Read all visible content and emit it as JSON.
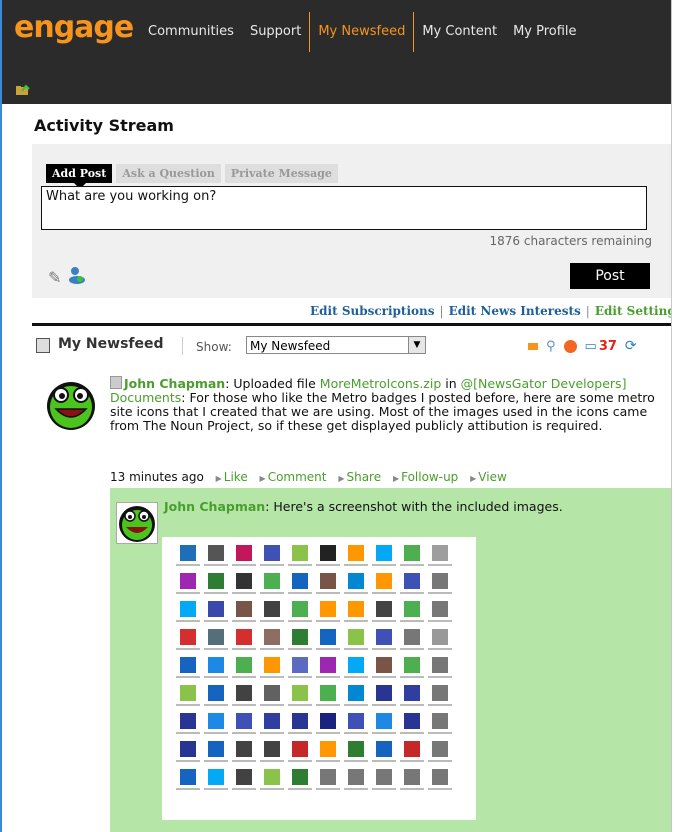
{
  "app": {
    "logo": "engage"
  },
  "nav": {
    "items": [
      "Communities",
      "Support",
      "My Newsfeed",
      "My Content",
      "My Profile"
    ],
    "active_index": 2
  },
  "stream": {
    "title": "Activity Stream",
    "tabs": [
      "Add Post",
      "Ask a Question",
      "Private Message"
    ],
    "post_value": "What are you working on?",
    "chars_remaining": "1876 characters remaining",
    "post_button": "Post"
  },
  "edit_links": [
    "Edit Subscriptions",
    "Edit News Interests",
    "Edit Settings"
  ],
  "feed": {
    "title": "My Newsfeed",
    "show_label": "Show:",
    "show_value": "My Newsfeed",
    "comment_count": "37"
  },
  "post": {
    "author": "John Chapman",
    "text_a": ": Uploaded file ",
    "file": "MoreMetroIcons.zip",
    "text_b": " in ",
    "location": "@[NewsGator Developers] Documents",
    "text_c": ": For those who like the Metro badges I posted before, here are some metro site icons that I created that we are using. Most of the images used in the icons came from The Noun Project, so if these get displayed publicly attibution is required.",
    "time": "13 minutes ago",
    "actions": [
      "Like",
      "Comment",
      "Share",
      "Follow-up",
      "View"
    ]
  },
  "comment": {
    "author": "John Chapman",
    "text": ": Here's a screenshot with the included images."
  },
  "colors": {
    "accent": "#f7941d",
    "link_green": "#4a9e2e",
    "comment_bg": "#b5e6a8",
    "topbar": "#2b2b2b"
  },
  "icon_colors": [
    "#1e6fb8",
    "#555555",
    "#c2185b",
    "#3f51b5",
    "#8bc34a",
    "#222222",
    "#ff9800",
    "#03a9f4",
    "#4caf50",
    "#9e9e9e",
    "#9c27b0",
    "#2e7d32",
    "#333333",
    "#4caf50",
    "#1565c0",
    "#795548",
    "#0288d1",
    "#ff9800",
    "#3f51b5",
    "#777777",
    "#03a9f4",
    "#3949ab",
    "#795548",
    "#424242",
    "#4caf50",
    "#ff9800",
    "#ff9800",
    "#444444",
    "#4caf50",
    "#777777",
    "#d32f2f",
    "#546e7a",
    "#d32f2f",
    "#8d6e63",
    "#2e7d32",
    "#1565c0",
    "#8bc34a",
    "#3f51b5",
    "#777777",
    "#999999",
    "#1565c0",
    "#1e88e5",
    "#4caf50",
    "#ff9800",
    "#5c6bc0",
    "#9c27b0",
    "#03a9f4",
    "#795548",
    "#4caf50",
    "#777777",
    "#8bc34a",
    "#1565c0",
    "#424242",
    "#616161",
    "#8bc34a",
    "#4caf50",
    "#0288d1",
    "#283593",
    "#303f9f",
    "#777777",
    "#283593",
    "#1e88e5",
    "#3f51b5",
    "#303f9f",
    "#283593",
    "#1a237e",
    "#3f51b5",
    "#1e88e5",
    "#283593",
    "#777777",
    "#283593",
    "#1565c0",
    "#424242",
    "#424242",
    "#c62828",
    "#ff9800",
    "#2e7d32",
    "#1565c0",
    "#c62828",
    "#777777",
    "#1565c0",
    "#03a9f4",
    "#424242",
    "#8bc34a",
    "#2e7d32",
    "#777777",
    "#777777",
    "#777777",
    "#777777",
    "#777777"
  ]
}
